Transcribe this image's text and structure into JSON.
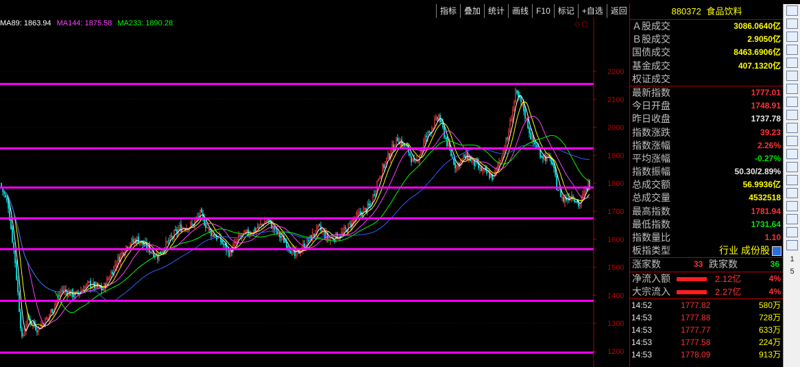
{
  "toolbar": [
    "指标",
    "叠加",
    "统计",
    "画线",
    "F10",
    "标记",
    "+自选",
    "返回"
  ],
  "ma_legend": [
    {
      "label": "MA89: 1863.94",
      "color": "#ffffff"
    },
    {
      "label": "MA144: 1875.58",
      "color": "#ff40ff"
    },
    {
      "label": "MA233: 1890.28",
      "color": "#00ff00"
    }
  ],
  "chart_ctrl": "◇ ▢",
  "chart_data": {
    "type": "candlestick",
    "y_ticks": [
      "2200",
      "2100",
      "2000",
      "1900",
      "1800",
      "1700",
      "1600",
      "1500",
      "1400",
      "1300",
      "1200"
    ],
    "y_values": [
      2200,
      2100,
      2000,
      1900,
      1800,
      1700,
      1600,
      1500,
      1400,
      1300,
      1200
    ],
    "ylim": [
      1165,
      2250
    ],
    "horizontal_levels": [
      2155,
      1925,
      1785,
      1675,
      1565,
      1380,
      1195
    ],
    "ma_series": [
      "MA89",
      "MA144",
      "MA233"
    ]
  },
  "panel": {
    "code": "880372",
    "name": "食品饮料",
    "stats": [
      {
        "label": "Ａ股成交",
        "value": "3086.0640亿",
        "color": "yellow"
      },
      {
        "label": "Ｂ股成交",
        "value": "2.9050亿",
        "color": "yellow"
      },
      {
        "label": "国债成交",
        "value": "8463.6906亿",
        "color": "yellow"
      },
      {
        "label": "基金成交",
        "value": "407.1320亿",
        "color": "yellow"
      },
      {
        "label": "权证成交",
        "value": "",
        "color": "yellow"
      }
    ],
    "index": [
      {
        "label": "最新指数",
        "value": "1777.01",
        "color": "red"
      },
      {
        "label": "今日开盘",
        "value": "1748.91",
        "color": "red"
      },
      {
        "label": "昨日收盘",
        "value": "1737.78",
        "color": "white"
      },
      {
        "label": "指数涨跌",
        "value": "39.23",
        "color": "red"
      },
      {
        "label": "指数涨幅",
        "value": "2.26%",
        "color": "red"
      },
      {
        "label": "平均涨幅",
        "value": "-0.27%",
        "color": "green"
      },
      {
        "label": "指数振幅",
        "value": "50.30/2.89%",
        "color": "white"
      },
      {
        "label": "总成交额",
        "value": "56.9936亿",
        "color": "yellow"
      },
      {
        "label": "总成交量",
        "value": "4532518",
        "color": "yellow"
      },
      {
        "label": "最高指数",
        "value": "1781.94",
        "color": "red"
      },
      {
        "label": "最低指数",
        "value": "1731.64",
        "color": "green"
      },
      {
        "label": "指数量比",
        "value": "1.10",
        "color": "red"
      },
      {
        "label": "板指类型",
        "value": "行业 成份股",
        "color": "yellow"
      }
    ],
    "updown": {
      "up_label": "涨家数",
      "up": "33",
      "down_label": "跌家数",
      "down": "36"
    },
    "flows": [
      {
        "label": "净流入额",
        "value": "2.12亿",
        "pct": "4%"
      },
      {
        "label": "大宗流入",
        "value": "2.27亿",
        "pct": "4%"
      }
    ],
    "ticks": [
      {
        "time": "14:52",
        "price": "1777.82",
        "vol": "580万"
      },
      {
        "time": "14:53",
        "price": "1777.88",
        "vol": "728万"
      },
      {
        "time": "14:53",
        "price": "1777.77",
        "vol": "633万"
      },
      {
        "time": "14:53",
        "price": "1777.58",
        "vol": "224万"
      },
      {
        "time": "14:53",
        "price": "1778.09",
        "vol": "913万"
      }
    ]
  },
  "sidebar": {
    "icons": [
      "chart-icon",
      "list-icon",
      "grid-icon",
      "table-icon",
      "line-icon",
      "candle-icon",
      "book-icon",
      "f10-icon",
      "f9-icon",
      "f-icon",
      "fz-icon",
      "f8-icon",
      "ring-icon",
      "rsi-icon",
      "arrow-icon",
      "move-icon",
      "pen-icon",
      "f5-icon",
      "refresh-icon"
    ],
    "texts": [
      "1",
      "5"
    ]
  }
}
